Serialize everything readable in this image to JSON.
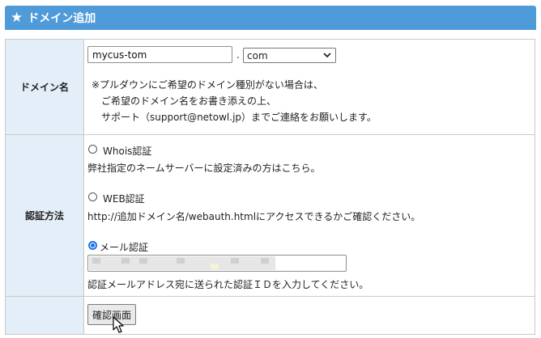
{
  "header": {
    "title": "ドメイン追加",
    "icon": "star-icon"
  },
  "domain_row": {
    "label": "ドメイン名",
    "name_value": "mycus-tom",
    "dot": ".",
    "tld_selected": "com",
    "note_line1": "※プルダウンにご希望のドメイン種別がない場合は、",
    "note_line2": "ご希望のドメイン名をお書き添えの上、",
    "note_line3": "サポート（support@netowl.jp）までご連絡をお願いします。"
  },
  "auth_row": {
    "label": "認証方法",
    "whois_label": "Whois認証",
    "whois_desc": "弊社指定のネームサーバーに設定済みの方はこちら。",
    "web_label": "WEB認証",
    "web_desc": "http://追加ドメイン名/webauth.htmlにアクセスできるかご確認ください。",
    "mail_label": "メール認証",
    "mail_value": "",
    "mail_desc": "認証メールアドレス宛に送られた認証ＩＤを入力してください。"
  },
  "submit_row": {
    "button_label": "確認画面"
  },
  "colors": {
    "header_bg": "#4f9ad8",
    "label_bg": "#e4eef9",
    "radio_checked": "#1a73e8"
  }
}
